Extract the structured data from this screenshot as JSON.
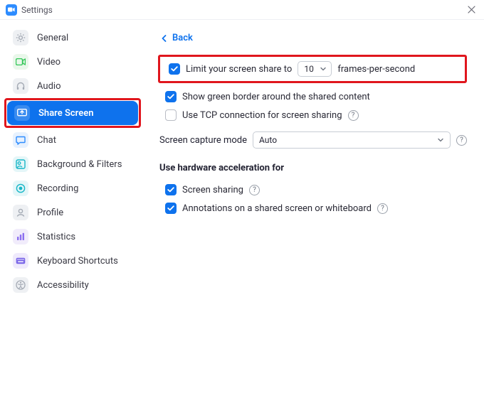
{
  "window": {
    "title": "Settings"
  },
  "sidebar": {
    "items": [
      {
        "label": "General"
      },
      {
        "label": "Video"
      },
      {
        "label": "Audio"
      },
      {
        "label": "Share Screen"
      },
      {
        "label": "Chat"
      },
      {
        "label": "Background & Filters"
      },
      {
        "label": "Recording"
      },
      {
        "label": "Profile"
      },
      {
        "label": "Statistics"
      },
      {
        "label": "Keyboard Shortcuts"
      },
      {
        "label": "Accessibility"
      }
    ]
  },
  "content": {
    "back_label": "Back",
    "fps_label_prefix": "Limit your screen share to",
    "fps_value": "10",
    "fps_label_suffix": "frames-per-second",
    "green_border_label": "Show green border around the shared content",
    "tcp_label": "Use TCP connection for screen sharing",
    "capture_mode_label": "Screen capture mode",
    "capture_mode_value": "Auto",
    "hw_accel_heading": "Use hardware acceleration for",
    "hw_screen_sharing_label": "Screen sharing",
    "hw_annotations_label": "Annotations on a shared screen or whiteboard"
  }
}
